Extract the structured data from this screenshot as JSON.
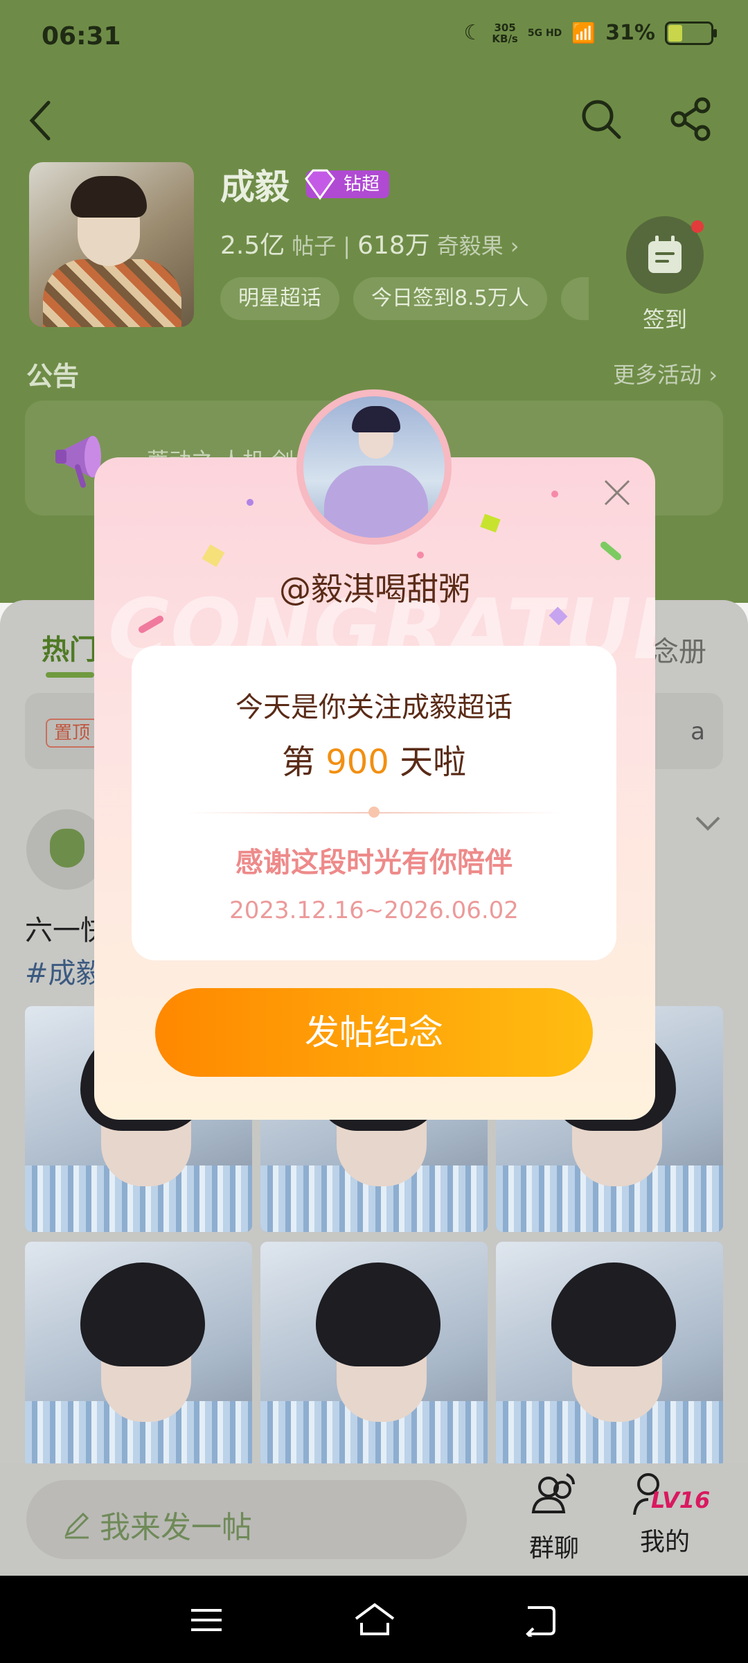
{
  "status_bar": {
    "time": "06:31",
    "speed_value": "305",
    "speed_unit": "KB/s",
    "network": "5G HD",
    "battery": "31%"
  },
  "header": {
    "star_name": "成毅",
    "vip_badge": "钻超",
    "posts_count": "2.5亿",
    "posts_label": "帖子",
    "fruit_count": "618万",
    "fruit_label": "奇毅果",
    "chips": [
      "明星超话",
      "今日签到8.5万人"
    ],
    "signin_label": "签到",
    "notice_title": "公告",
    "more_activities": "更多活动",
    "notice_text": "蒂动之 人机 剑"
  },
  "tabs": {
    "hot": "热门",
    "album": "念册"
  },
  "pinned": {
    "tag": "置顶",
    "text": "a"
  },
  "post": {
    "title": "六一快乐",
    "hashtag": "#成毅"
  },
  "bottom_bar": {
    "compose_placeholder": "我来发一帖",
    "group_chat": "群聊",
    "mine": "我的",
    "level": "LV16"
  },
  "modal": {
    "watermark": "CONGRATULATE",
    "handle": "@毅淇喝甜粥",
    "line1": "今天是你关注成毅超话",
    "line2_prefix": "第",
    "line2_number": "900",
    "line2_suffix": "天啦",
    "thanks": "感谢这段时光有你陪伴",
    "date_range": "2023.12.16~2026.06.02",
    "cta": "发帖纪念"
  },
  "colors": {
    "header_bg": "#6e8c47",
    "accent_orange": "#f28f11",
    "cta_start": "#ff8800",
    "cta_end": "#ffbd11",
    "vip_purple": "#b04ad3"
  },
  "icons": [
    "back-icon",
    "search-icon",
    "share-icon",
    "gem-icon",
    "calendar-icon",
    "megaphone-icon",
    "chevron-down-icon",
    "close-icon",
    "pencil-icon",
    "group-chat-icon",
    "profile-icon",
    "menu-icon",
    "home-icon",
    "return-icon"
  ]
}
